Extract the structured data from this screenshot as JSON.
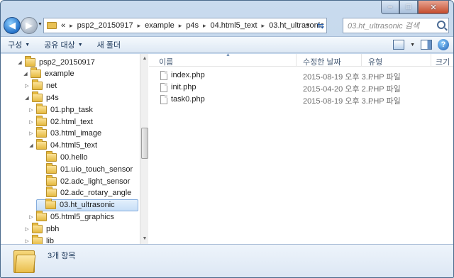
{
  "window": {
    "caption": {
      "minimize": "–",
      "maximize": "□",
      "close": "✕"
    }
  },
  "address_bar": {
    "overflow": "«",
    "crumbs": [
      "psp2_20150917",
      "example",
      "p4s",
      "04.html5_text",
      "03.ht_ultrasonic"
    ],
    "separator": "▸"
  },
  "search": {
    "placeholder": "03.ht_ultrasonic 검색"
  },
  "toolbar": {
    "organize": "구성",
    "share": "공유 대상",
    "new_folder": "새 폴더"
  },
  "tree": [
    {
      "label": "psp2_20150917",
      "expander": "◢",
      "depth": 1,
      "selected": false
    },
    {
      "label": "example",
      "expander": "◢",
      "depth": 2,
      "selected": false
    },
    {
      "label": "net",
      "expander": "▷",
      "depth": 3,
      "selected": false
    },
    {
      "label": "p4s",
      "expander": "◢",
      "depth": 3,
      "selected": false
    },
    {
      "label": "01.php_task",
      "expander": "▷",
      "depth": 4,
      "selected": false
    },
    {
      "label": "02.html_text",
      "expander": "▷",
      "depth": 4,
      "selected": false
    },
    {
      "label": "03.html_image",
      "expander": "▷",
      "depth": 4,
      "selected": false
    },
    {
      "label": "04.html5_text",
      "expander": "◢",
      "depth": 4,
      "selected": false
    },
    {
      "label": "00.hello",
      "expander": "",
      "depth": 5,
      "selected": false
    },
    {
      "label": "01.uio_touch_sensor",
      "expander": "",
      "depth": 5,
      "selected": false
    },
    {
      "label": "02.adc_light_sensor",
      "expander": "",
      "depth": 5,
      "selected": false
    },
    {
      "label": "02.adc_rotary_angle",
      "expander": "",
      "depth": 5,
      "selected": false
    },
    {
      "label": "03.ht_ultrasonic",
      "expander": "",
      "depth": 5,
      "selected": true
    },
    {
      "label": "05.html5_graphics",
      "expander": "▷",
      "depth": 4,
      "selected": false
    },
    {
      "label": "pbh",
      "expander": "▷",
      "depth": 3,
      "selected": false
    },
    {
      "label": "lib",
      "expander": "▷",
      "depth": 3,
      "selected": false
    }
  ],
  "columns": {
    "name": "이름",
    "date": "수정한 날짜",
    "type": "유형",
    "size": "크기"
  },
  "files": [
    {
      "name": "index.php",
      "date": "2015-08-19 오후 3...",
      "type": "PHP 파일"
    },
    {
      "name": "init.php",
      "date": "2015-04-20 오후 2...",
      "type": "PHP 파일"
    },
    {
      "name": "task0.php",
      "date": "2015-08-19 오후 3...",
      "type": "PHP 파일"
    }
  ],
  "status": {
    "item_count": "3개 항목"
  },
  "icons": {
    "back": "back-arrow-icon",
    "forward": "forward-arrow-icon",
    "folder": "folder-icon",
    "file": "php-file-icon",
    "search": "search-icon",
    "help": "help-icon"
  },
  "colors": {
    "selection": "#c7def7",
    "folder": "#e5b93f",
    "chrome": "#b8cde6"
  }
}
